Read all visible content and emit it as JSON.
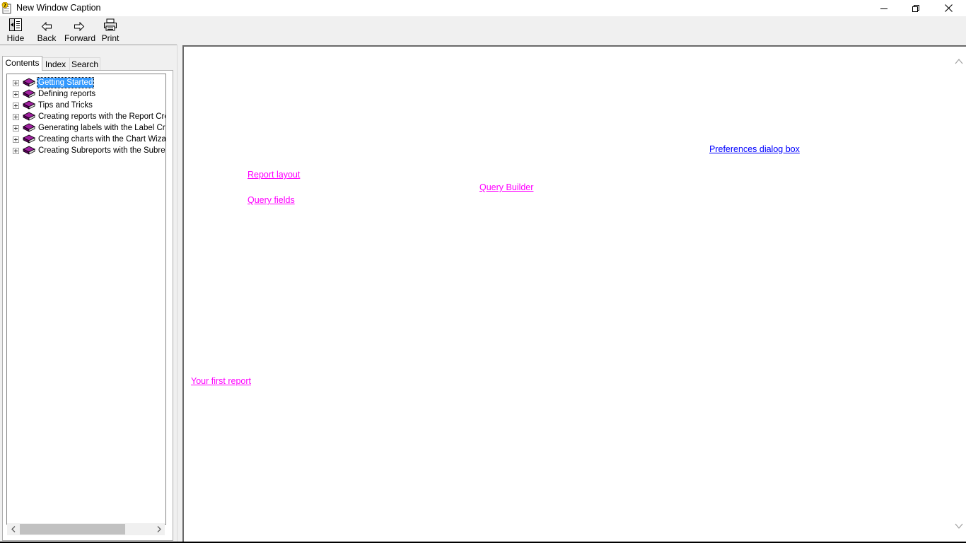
{
  "window": {
    "title": "New Window Caption",
    "controls": [
      "minimize",
      "restore",
      "close"
    ]
  },
  "toolbar": {
    "buttons": [
      {
        "label": "Hide",
        "icon": "hide-icon"
      },
      {
        "label": "Back",
        "icon": "back-arrow-icon"
      },
      {
        "label": "Forward",
        "icon": "forward-arrow-icon"
      },
      {
        "label": "Print",
        "icon": "printer-icon"
      }
    ]
  },
  "navpane": {
    "tabs": [
      {
        "label": "Contents",
        "active": true
      },
      {
        "label": "Index",
        "active": false
      },
      {
        "label": "Search",
        "active": false
      }
    ],
    "tree": [
      {
        "label": "Getting Started",
        "selected": true
      },
      {
        "label": "Defining reports",
        "selected": false
      },
      {
        "label": "Tips and Tricks",
        "selected": false
      },
      {
        "label": "Creating reports with the  Report Crea",
        "selected": false
      },
      {
        "label": "Generating labels with the Label Creat",
        "selected": false
      },
      {
        "label": "Creating charts with the Chart Wizard",
        "selected": false
      },
      {
        "label": "Creating Subreports with the Subrepor",
        "selected": false
      }
    ]
  },
  "content": {
    "links": [
      {
        "label": "Preferences dialog box",
        "color": "#0000ff"
      },
      {
        "label": "Report layout",
        "color": "#ff00ff"
      },
      {
        "label": "Query Builder",
        "color": "#ff00ff"
      },
      {
        "label": "Query fields",
        "color": "#ff00ff"
      },
      {
        "label": "Your first report",
        "color": "#ff00ff"
      }
    ]
  },
  "colors": {
    "selection": "#3399ff",
    "book": "#800080",
    "visited_link": "#ff00ff",
    "link": "#0000ff"
  }
}
